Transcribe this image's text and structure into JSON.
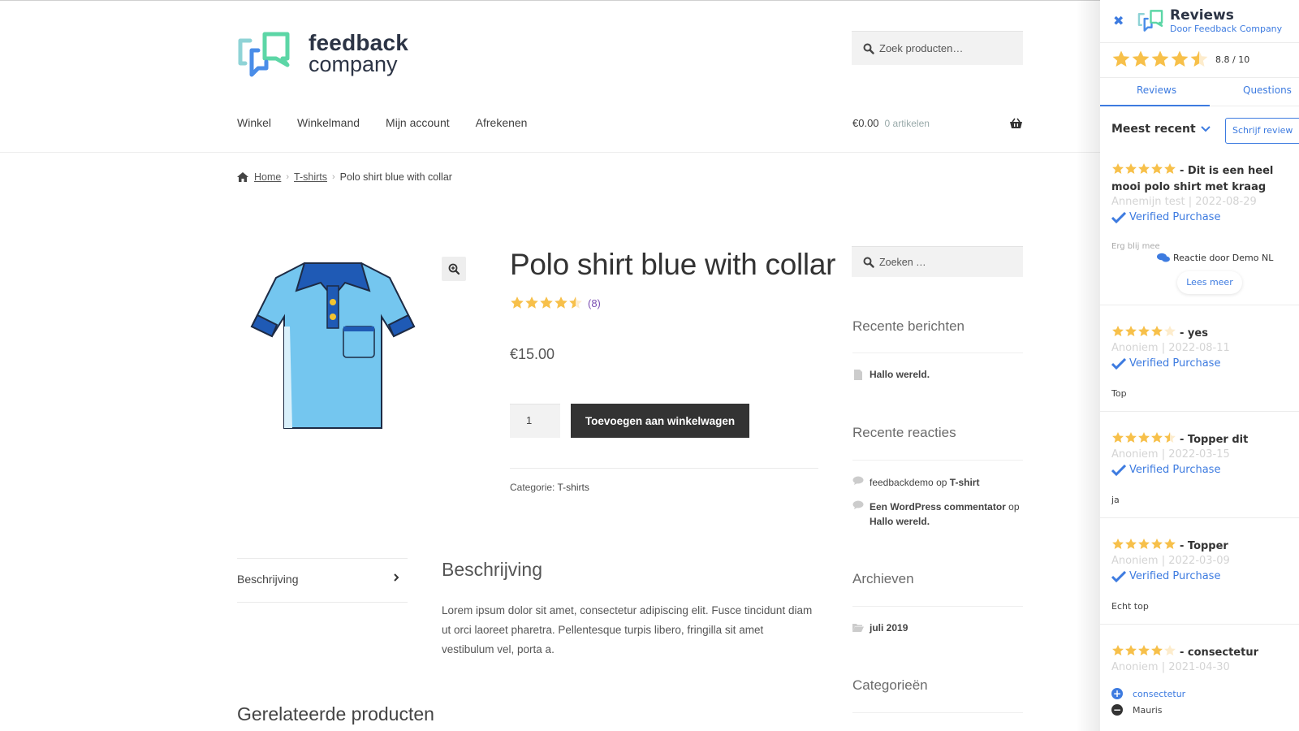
{
  "brand": {
    "logo_line1": "feedback",
    "logo_line2": "company"
  },
  "header": {
    "search_placeholder": "Zoek producten…",
    "nav": [
      "Winkel",
      "Winkelmand",
      "Mijn account",
      "Afrekenen"
    ],
    "cart_amount": "€0.00",
    "cart_count": "0 artikelen"
  },
  "breadcrumb": {
    "home": "Home",
    "category": "T-shirts",
    "current": "Polo shirt blue with collar"
  },
  "product": {
    "title": "Polo shirt blue with collar",
    "rating": 4.5,
    "rating_max": 5,
    "review_count": "(8)",
    "price": "€15.00",
    "quantity": "1",
    "add_to_cart": "Toevoegen aan winkelwagen",
    "category_label": "Categorie:",
    "category_value": "T-shirts"
  },
  "tabs": {
    "description_tab": "Beschrijving"
  },
  "description": {
    "title": "Beschrijving",
    "text": "Lorem ipsum dolor sit amet, consectetur adipiscing elit. Fusce tincidunt diam ut orci laoreet pharetra. Pellentesque turpis libero, fringilla sit amet vestibulum vel, porta a."
  },
  "related_title": "Gerelateerde producten",
  "sidebar": {
    "search_placeholder": "Zoeken …",
    "recent_posts_title": "Recente berichten",
    "recent_posts": [
      "Hallo wereld."
    ],
    "recent_comments_title": "Recente reacties",
    "recent_comments": [
      {
        "author": "feedbackdemo",
        "sep": "op",
        "post": "T-shirt"
      },
      {
        "author": "Een WordPress commentator",
        "sep": "op",
        "post": "Hallo wereld."
      }
    ],
    "archives_title": "Archieven",
    "archives": [
      "juli 2019"
    ],
    "categories_title": "Categorieën"
  },
  "panel": {
    "title": "Reviews",
    "subtitle": "Door Feedback Company",
    "score": "8.8 / 10",
    "overall_stars": 4.5,
    "tabs": [
      "Reviews",
      "Questions"
    ],
    "sort_label": "Meest recent",
    "write_review": "Schrijf review",
    "verified_label": "Verified Purchase",
    "reviews": [
      {
        "stars": 5,
        "title": "- Dit is een heel mooi polo shirt met kraag",
        "meta": "Annemijn test | 2022-08-29",
        "verified": true,
        "body": "Erg blij mee",
        "reply": "Reactie door Demo NL",
        "read_more": "Lees meer"
      },
      {
        "stars": 4,
        "title": "- yes",
        "meta": "Anoniem | 2022-08-11",
        "verified": true,
        "body": "Top"
      },
      {
        "stars": 4.5,
        "title": "- Topper dit",
        "meta": "Anoniem | 2022-03-15",
        "verified": true,
        "body": "ja"
      },
      {
        "stars": 5,
        "title": "- Topper",
        "meta": "Anoniem | 2022-03-09",
        "verified": true,
        "body": "Echt top"
      },
      {
        "stars": 4,
        "title": "- consectetur",
        "meta": "Anoniem | 2021-04-30",
        "verified": false,
        "pro": "consectetur",
        "con": "Mauris"
      }
    ]
  },
  "colors": {
    "accent": "#3d7be0",
    "star": "#f7c04a",
    "star_empty": "#fdeccc",
    "button_dark": "#333333",
    "count_purple": "#7b4fb3"
  }
}
